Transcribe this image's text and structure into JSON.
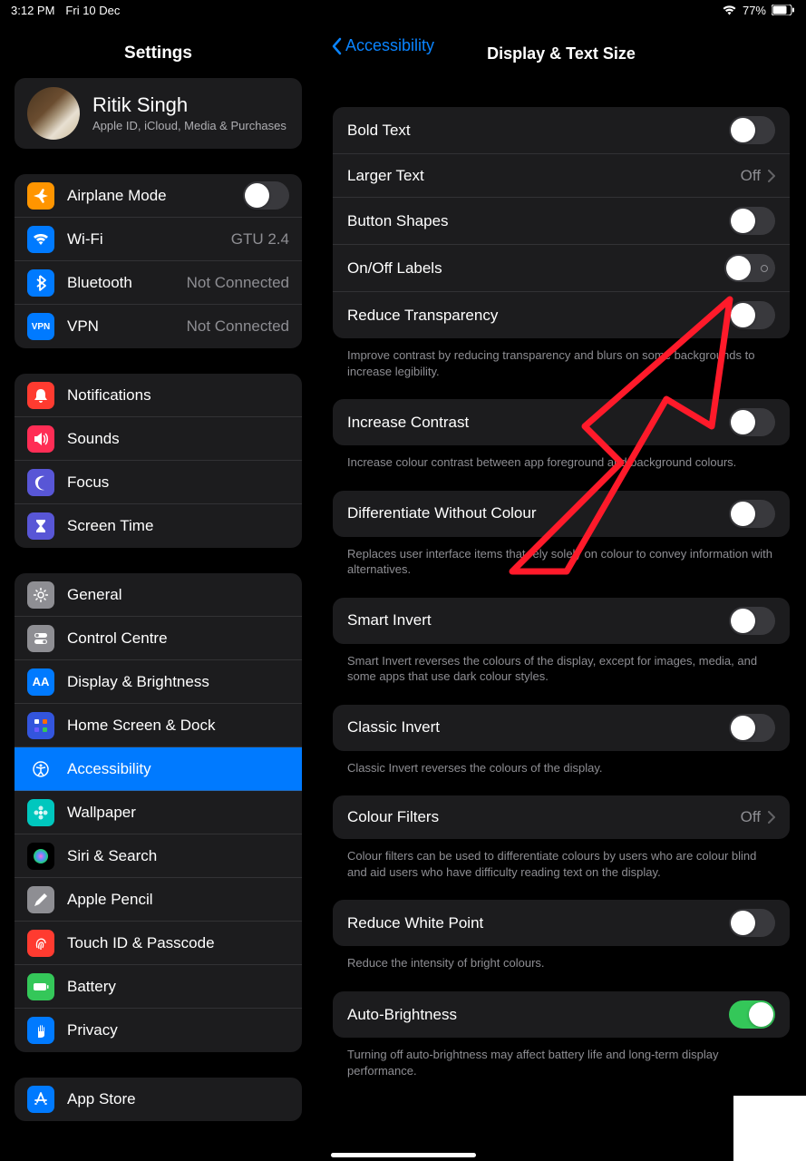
{
  "status": {
    "time": "3:12 PM",
    "date": "Fri 10 Dec",
    "battery": "77%"
  },
  "sidebar": {
    "title": "Settings",
    "profile": {
      "name": "Ritik Singh",
      "sub": "Apple ID, iCloud, Media & Purchases"
    },
    "g1": [
      {
        "icon": "airplane",
        "color": "#ff9500",
        "label": "Airplane Mode",
        "toggle": false
      },
      {
        "icon": "wifi",
        "color": "#007aff",
        "label": "Wi-Fi",
        "value": "GTU 2.4"
      },
      {
        "icon": "bluetooth",
        "color": "#007aff",
        "label": "Bluetooth",
        "value": "Not Connected"
      },
      {
        "icon": "vpn",
        "color": "#007aff",
        "label": "VPN",
        "value": "Not Connected"
      }
    ],
    "g2": [
      {
        "icon": "bell",
        "color": "#ff3b30",
        "label": "Notifications"
      },
      {
        "icon": "speaker",
        "color": "#ff2d55",
        "label": "Sounds"
      },
      {
        "icon": "moon",
        "color": "#5856d6",
        "label": "Focus"
      },
      {
        "icon": "hourglass",
        "color": "#5856d6",
        "label": "Screen Time"
      }
    ],
    "g3": [
      {
        "icon": "gear",
        "color": "#8e8e93",
        "label": "General"
      },
      {
        "icon": "switches",
        "color": "#8e8e93",
        "label": "Control Centre"
      },
      {
        "icon": "aa",
        "color": "#007aff",
        "label": "Display & Brightness"
      },
      {
        "icon": "grid",
        "color": "#3355dd",
        "label": "Home Screen & Dock"
      },
      {
        "icon": "accessibility",
        "color": "#007aff",
        "label": "Accessibility",
        "selected": true
      },
      {
        "icon": "flower",
        "color": "#00c7be",
        "label": "Wallpaper"
      },
      {
        "icon": "siri",
        "color": "#000",
        "label": "Siri & Search"
      },
      {
        "icon": "pencil",
        "color": "#8e8e93",
        "label": "Apple Pencil"
      },
      {
        "icon": "fingerprint",
        "color": "#ff3b30",
        "label": "Touch ID & Passcode"
      },
      {
        "icon": "battery",
        "color": "#34c759",
        "label": "Battery"
      },
      {
        "icon": "hand",
        "color": "#007aff",
        "label": "Privacy"
      }
    ],
    "g4": [
      {
        "icon": "appstore",
        "color": "#007aff",
        "label": "App Store"
      }
    ]
  },
  "main": {
    "back": "Accessibility",
    "title": "Display & Text Size",
    "s1": [
      {
        "label": "Bold Text",
        "toggle": false
      },
      {
        "label": "Larger Text",
        "value": "Off",
        "chevron": true
      },
      {
        "label": "Button Shapes",
        "toggle": false
      },
      {
        "label": "On/Off Labels",
        "onoff": false
      },
      {
        "label": "Reduce Transparency",
        "toggle": false
      }
    ],
    "s1_footer": "Improve contrast by reducing transparency and blurs on some backgrounds to increase legibility.",
    "s2": [
      {
        "label": "Increase Contrast",
        "toggle": false
      }
    ],
    "s2_footer": "Increase colour contrast between app foreground and background colours.",
    "s3": [
      {
        "label": "Differentiate Without Colour",
        "toggle": false
      }
    ],
    "s3_footer": "Replaces user interface items that rely solely on colour to convey information with alternatives.",
    "s4": [
      {
        "label": "Smart Invert",
        "toggle": false
      }
    ],
    "s4_footer": "Smart Invert reverses the colours of the display, except for images, media, and some apps that use dark colour styles.",
    "s5": [
      {
        "label": "Classic Invert",
        "toggle": false
      }
    ],
    "s5_footer": "Classic Invert reverses the colours of the display.",
    "s6": [
      {
        "label": "Colour Filters",
        "value": "Off",
        "chevron": true
      }
    ],
    "s6_footer": "Colour filters can be used to differentiate colours by users who are colour blind and aid users who have difficulty reading text on the display.",
    "s7": [
      {
        "label": "Reduce White Point",
        "toggle": false
      }
    ],
    "s7_footer": "Reduce the intensity of bright colours.",
    "s8": [
      {
        "label": "Auto-Brightness",
        "toggle": true
      }
    ],
    "s8_footer": "Turning off auto-brightness may affect battery life and long-term display performance."
  }
}
